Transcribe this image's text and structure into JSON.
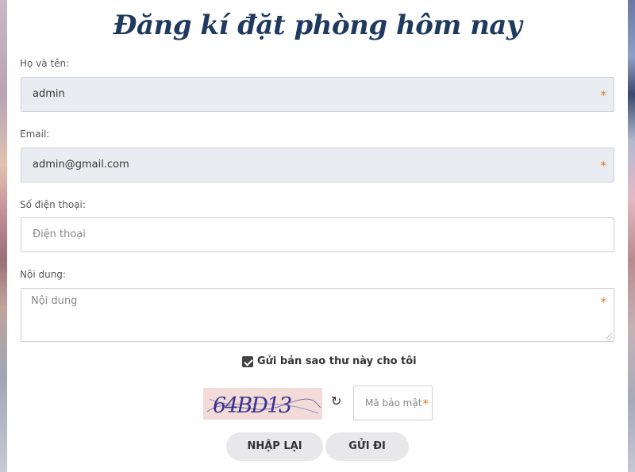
{
  "form": {
    "title": "Đăng kí đặt phòng hôm nay",
    "name_label": "Họ và tên:",
    "name_value": "admin",
    "email_label": "Email:",
    "email_value": "admin@gmail.com",
    "phone_label": "Số điện thoại:",
    "phone_placeholder": "Điện thoại",
    "content_label": "Nội dung:",
    "content_placeholder": "Nội dung",
    "required_mark": "*",
    "copy_checkbox_label": "Gửi bản sao thư này cho tôi",
    "copy_checked": true,
    "captcha_text": "64BD13",
    "captcha_placeholder": "Mã bảo mật",
    "reset_label": "NHẬP LẠI",
    "submit_label": "GỬI ĐI"
  },
  "colors": {
    "title": "#1e3a5f",
    "required": "#e07a1f",
    "filled_field_bg": "#e9ecf0",
    "button_bg": "#e8e8ea"
  },
  "icons": {
    "refresh": "refresh-icon"
  }
}
